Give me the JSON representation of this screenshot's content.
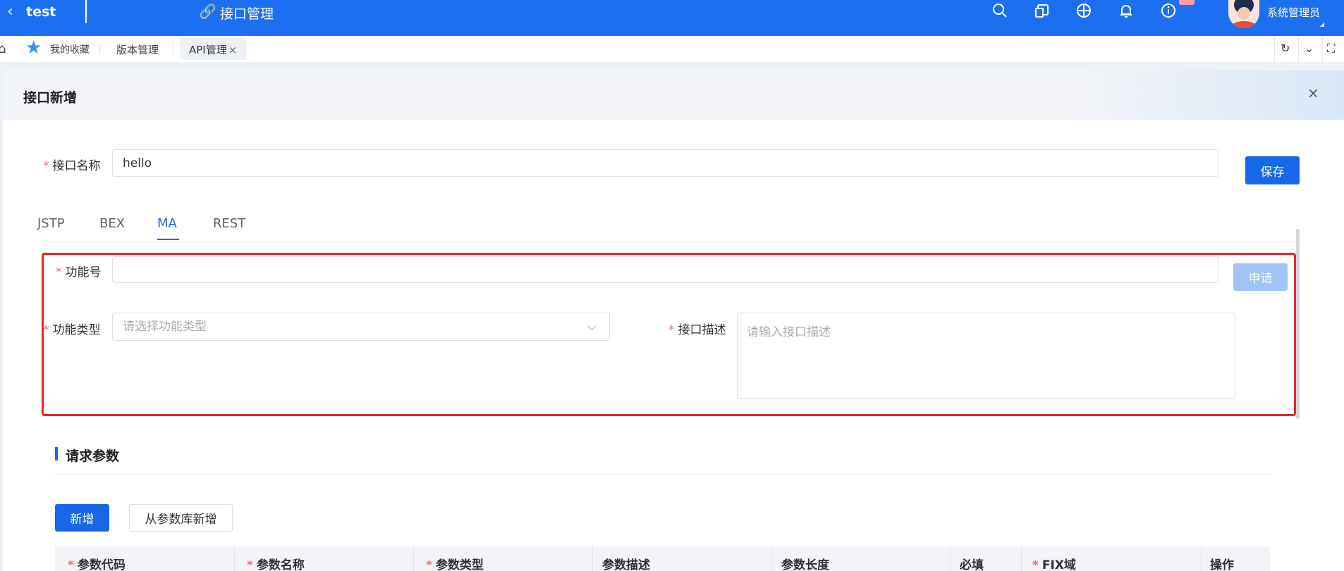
{
  "header": {
    "back_icon": "chevron-left-icon",
    "app_name": "test",
    "module_icon": "link-icon",
    "module_name": "接口管理",
    "icons": [
      "search-icon",
      "copy-icon",
      "globe-icon",
      "bell-icon",
      "info-icon"
    ],
    "user_name": "系统管理员",
    "brand_color": "#1d6ff2"
  },
  "tabbar": {
    "favorites_label": "我的收藏",
    "tabs": [
      "版本管理",
      "API管理"
    ],
    "active_tab": "API管理",
    "close_glyph": "×"
  },
  "panel": {
    "title": "接口新增",
    "close_glyph": "×"
  },
  "form": {
    "name_label": "接口名称",
    "name_value": "hello",
    "save_label": "保存",
    "protocol_tabs": [
      "JSTP",
      "BEX",
      "MA",
      "REST"
    ],
    "active_protocol": "MA",
    "func_no_label": "功能号",
    "func_no_value": "",
    "apply_label": "申请",
    "func_type_label": "功能类型",
    "func_type_placeholder": "请选择功能类型",
    "desc_label": "接口描述",
    "desc_placeholder": "请输入接口描述",
    "required_mark": "*"
  },
  "request_params": {
    "title": "请求参数",
    "add_label": "新增",
    "add_from_lib_label": "从参数库新增",
    "columns": [
      "参数代码",
      "参数名称",
      "参数类型",
      "参数描述",
      "参数长度",
      "必填",
      "FIX域",
      "操作"
    ],
    "required_columns": [
      "参数代码",
      "参数名称",
      "参数类型",
      "FIX域"
    ]
  }
}
